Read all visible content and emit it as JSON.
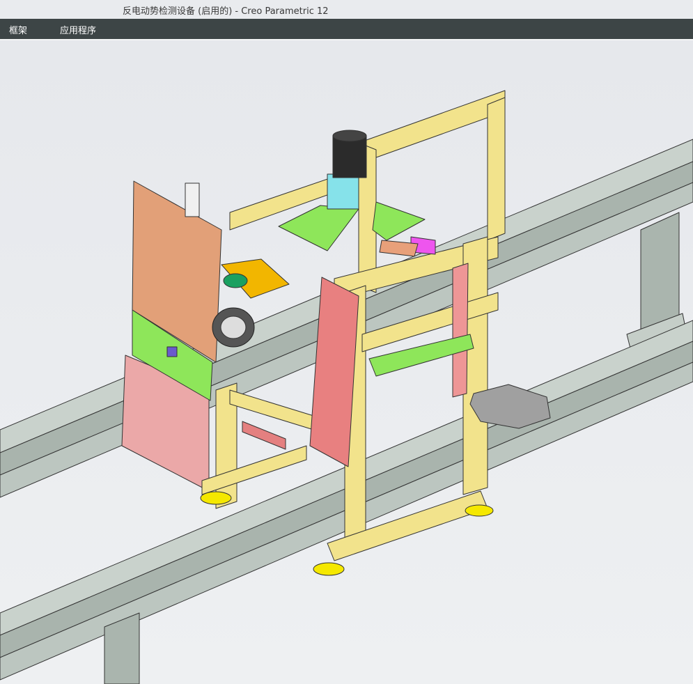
{
  "window": {
    "title": "反电动势检测设备 (启用的) - Creo Parametric 12"
  },
  "menubar": {
    "items": [
      {
        "label": "框架"
      },
      {
        "label": "应用程序"
      }
    ]
  },
  "colors": {
    "titlebar_bg": "#e9ebee",
    "menubar_bg": "#3d4546",
    "viewport_bg": "#ebecef",
    "frame_yellow": "#f2e38c",
    "panel_orange": "#e2a078",
    "panel_green": "#8ee65a",
    "panel_pink": "#e48080",
    "rail_gray": "#b9c3bd",
    "motor_black": "#2b2b2b",
    "cyan_part": "#86e2ea",
    "gold_plate": "#f2b600",
    "magenta_part": "#ee55ee",
    "foot_yellow": "#f5e800"
  }
}
